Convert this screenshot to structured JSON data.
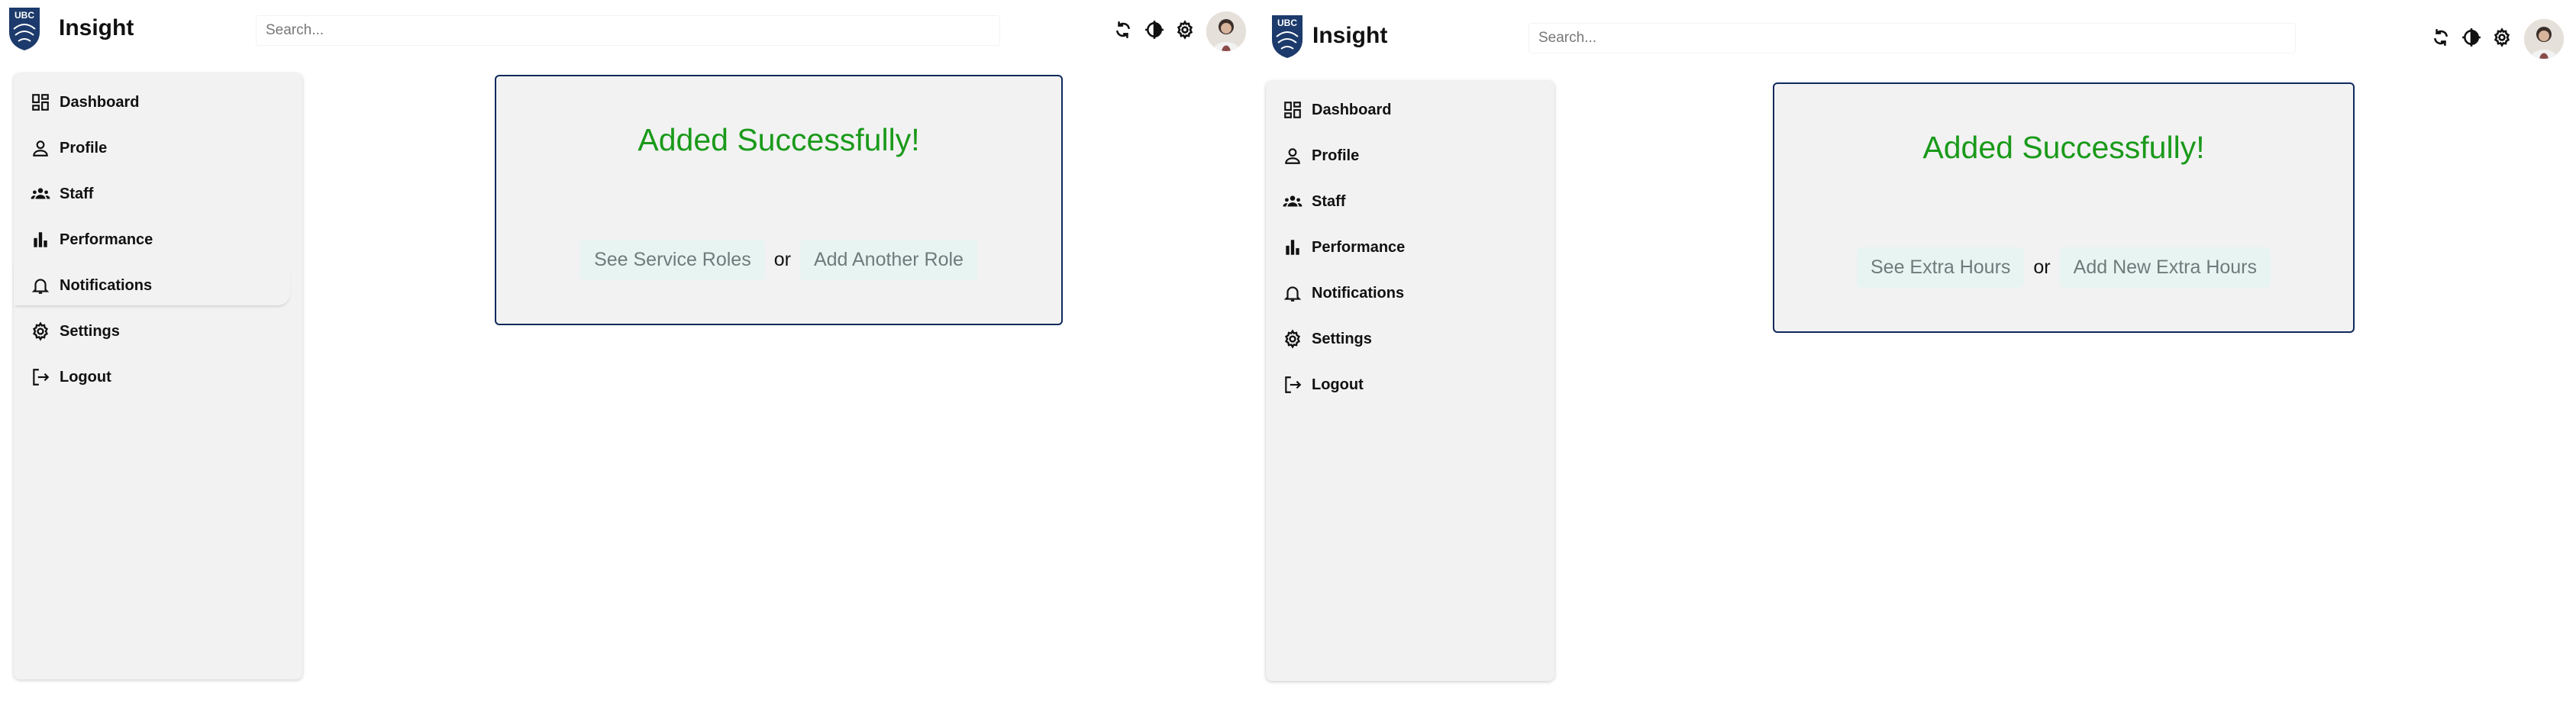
{
  "panels": [
    {
      "header": {
        "app_title": "Insight",
        "logo_text": "UBC",
        "search_placeholder": "Search..."
      },
      "nav": [
        {
          "label": "Dashboard",
          "icon": "dashboard-icon"
        },
        {
          "label": "Profile",
          "icon": "profile-icon"
        },
        {
          "label": "Staff",
          "icon": "staff-icon"
        },
        {
          "label": "Performance",
          "icon": "performance-icon"
        },
        {
          "label": "Notifications",
          "icon": "bell-icon"
        },
        {
          "label": "Settings",
          "icon": "gear-icon"
        },
        {
          "label": "Logout",
          "icon": "logout-icon"
        }
      ],
      "message": {
        "title": "Added Successfully!",
        "primary_action": "See Service Roles",
        "or_text": "or",
        "secondary_action": "Add Another Role"
      }
    },
    {
      "header": {
        "app_title": "Insight",
        "logo_text": "UBC",
        "search_placeholder": "Search..."
      },
      "nav": [
        {
          "label": "Dashboard",
          "icon": "dashboard-icon"
        },
        {
          "label": "Profile",
          "icon": "profile-icon"
        },
        {
          "label": "Staff",
          "icon": "staff-icon"
        },
        {
          "label": "Performance",
          "icon": "performance-icon"
        },
        {
          "label": "Notifications",
          "icon": "bell-icon"
        },
        {
          "label": "Settings",
          "icon": "gear-icon"
        },
        {
          "label": "Logout",
          "icon": "logout-icon"
        }
      ],
      "message": {
        "title": "Added Successfully!",
        "primary_action": "See Extra Hours",
        "or_text": "or",
        "secondary_action": "Add New Extra Hours"
      }
    }
  ],
  "colors": {
    "success_text": "#1a9a1a",
    "card_border": "#0e2a5c",
    "action_button_bg": "#e8f4f2",
    "sidebar_bg": "#f2f2f2"
  }
}
